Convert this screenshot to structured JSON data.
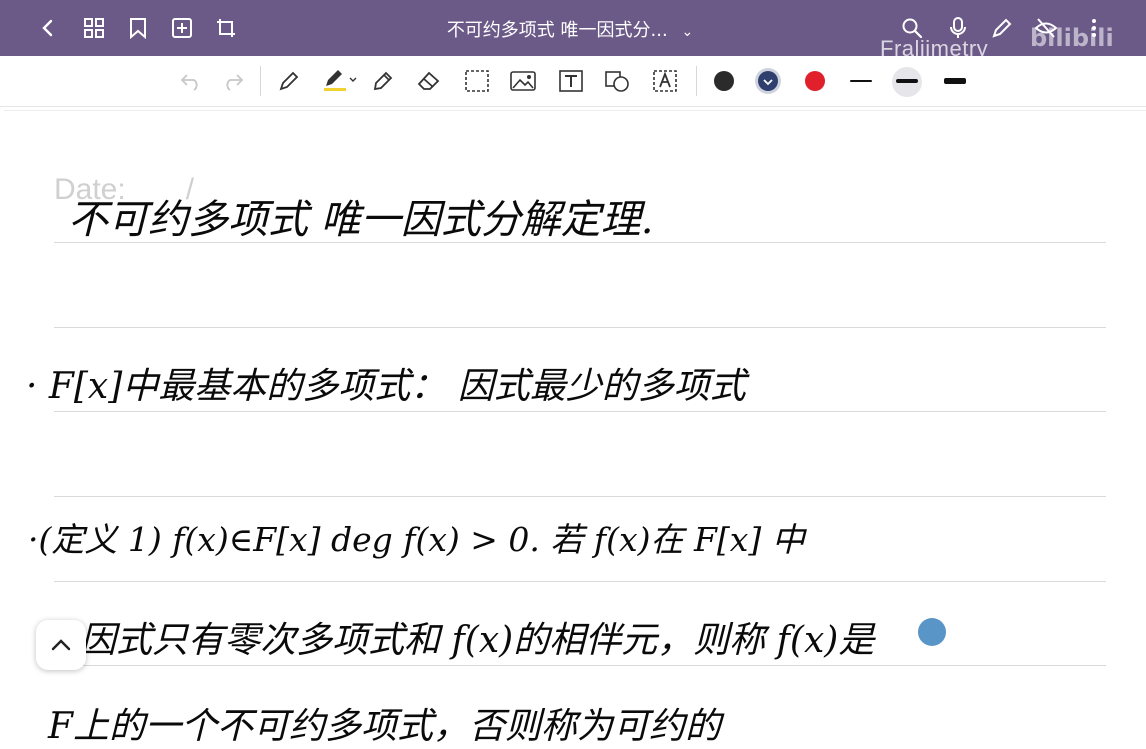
{
  "app": {
    "doc_title": "不可约多项式 唯一因式分...",
    "watermark": "Fraliimetry",
    "site_logo": "bilibili"
  },
  "topbar_icons": [
    "back-chevron-icon",
    "grid-icon",
    "bookmark-icon",
    "add-page-icon",
    "crop-icon",
    "search-icon",
    "microphone-icon",
    "pen-mode-icon",
    "visibility-off-icon",
    "more-icon"
  ],
  "toolbar": {
    "tools": [
      "undo-icon",
      "redo-icon",
      "pen-icon",
      "highlighter-icon",
      "pencil-icon",
      "eraser-icon",
      "lasso-icon",
      "image-icon",
      "text-icon",
      "shapes-icon",
      "ocr-text-icon"
    ],
    "colors": [
      "#2b2b2b",
      "#2f3f6e",
      "#e0202a"
    ],
    "stroke_widths": [
      "thin",
      "medium",
      "thick"
    ]
  },
  "note": {
    "date_label": "Date:",
    "date_slash": "/",
    "lines": [
      "不可约多项式  唯一因式分解定理.",
      "· F[x]中最基本的多项式：  因式最少的多项式",
      "·(定义 1)  f(x)∈F[x]   deg f(x) > 0.  若 f(x)在 F[x] 中",
      "的因式只有零次多项式和 f(x)的相伴元，则称 f(x)是",
      "F上的一个不可约多项式，否则称为可约的"
    ]
  }
}
